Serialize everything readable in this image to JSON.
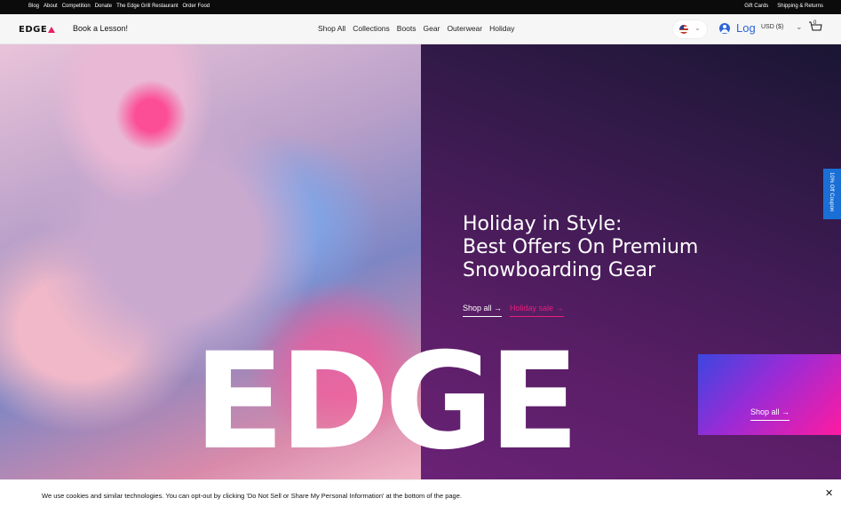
{
  "topbar": {
    "left_links": [
      "Blog",
      "About",
      "Competition",
      "Donate",
      "The Edge Grill Restaurant",
      "Order Food"
    ],
    "right_links": [
      "Gift Cards",
      "Shipping & Returns"
    ]
  },
  "header": {
    "logo": "EDGE",
    "book_lesson": "Book a Lesson!",
    "nav": [
      "Shop All",
      "Collections",
      "Boots",
      "Gear",
      "Outerwear",
      "Holiday"
    ],
    "login": "Log",
    "currency": "USD ($)",
    "cart_count": "0"
  },
  "hero": {
    "title_lines": [
      "Holiday in Style:",
      "Best Offers On Premium",
      "Snowboarding Gear"
    ],
    "shop_all": "Shop all →",
    "holiday_sale": "Holiday sale →",
    "big_word": "EDGE",
    "panel_shop_all": "Shop all →"
  },
  "coupon": {
    "label": "10% Off Coupon"
  },
  "cookie": {
    "text": "We use cookies and similar technologies. You can opt-out by clicking 'Do Not Sell or Share My Personal Information' at the bottom of the page.",
    "close": "✕"
  },
  "colors": {
    "accent_pink": "#e91e7a",
    "link_blue": "#2e64d6",
    "coupon_blue": "#1a6fd6"
  }
}
